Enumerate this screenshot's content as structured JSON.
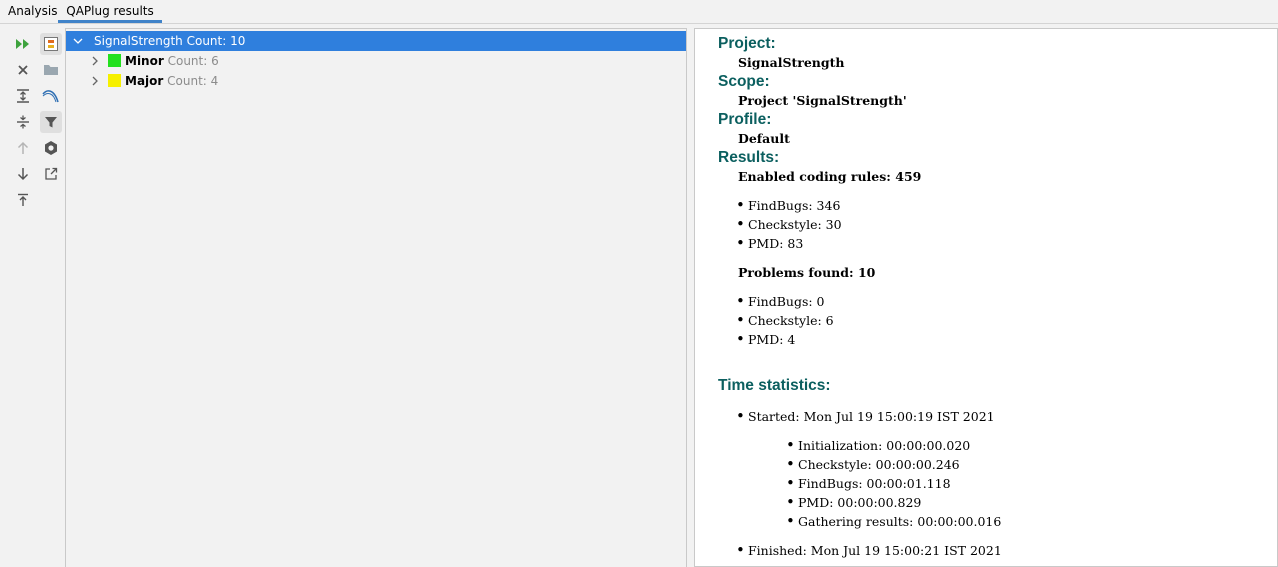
{
  "tabs": [
    {
      "label": "Analysis"
    },
    {
      "label": "QAPlug results"
    }
  ],
  "toolbar": {
    "icons": [
      "run-icon",
      "group-icon",
      "close-icon",
      "folder-icon",
      "expand-all-icon",
      "curve-icon",
      "collapse-all-icon",
      "filter-icon",
      "up-arrow-icon",
      "settings-icon",
      "down-arrow-icon",
      "export-icon",
      "pin-icon"
    ]
  },
  "tree": {
    "root": {
      "name": "SignalStrength",
      "count": "Count: 10"
    },
    "children": [
      {
        "name": "Minor",
        "count": "Count: 6",
        "color": "#22e01e"
      },
      {
        "name": "Major",
        "count": "Count: 4",
        "color": "#f6f000"
      }
    ]
  },
  "details": {
    "project_heading": "Project:",
    "project_value": "SignalStrength",
    "scope_heading": "Scope:",
    "scope_value": "Project 'SignalStrength'",
    "profile_heading": "Profile:",
    "profile_value": "Default",
    "results_heading": "Results:",
    "enabled_rules": "Enabled coding rules: 459",
    "rules": [
      "FindBugs: 346",
      "Checkstyle: 30",
      "PMD: 83"
    ],
    "problems_found": "Problems found: 10",
    "problems": [
      "FindBugs: 0",
      "Checkstyle: 6",
      "PMD: 4"
    ],
    "time_heading": "Time statistics:",
    "started": "Started: Mon Jul 19 15:00:19 IST 2021",
    "timings": [
      "Initialization: 00:00:00.020",
      "Checkstyle: 00:00:00.246",
      "FindBugs: 00:00:01.118",
      "PMD: 00:00:00.829",
      "Gathering results: 00:00:00.016"
    ],
    "finished": "Finished: Mon Jul 19 15:00:21 IST 2021"
  }
}
